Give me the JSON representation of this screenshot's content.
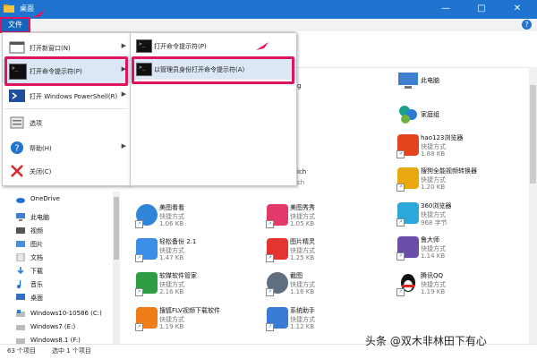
{
  "window": {
    "title": "桌面",
    "controls": {
      "minimize": "—",
      "maximize": "□",
      "close": "✕"
    }
  },
  "ribbon": {
    "file_tab": "文件"
  },
  "file_menu": {
    "items": [
      {
        "label": "打开新窗口(N)",
        "icon": "window-icon",
        "has_submenu": true
      },
      {
        "label": "打开命令提示符(P)",
        "icon": "cmd-icon",
        "has_submenu": true,
        "highlighted": true
      },
      {
        "label": "打开 Windows PowerShell(R)",
        "icon": "powershell-icon",
        "has_submenu": true
      },
      {
        "label": "选项",
        "icon": "options-icon",
        "has_submenu": false
      },
      {
        "label": "帮助(H)",
        "icon": "help-icon",
        "has_submenu": true
      },
      {
        "label": "关闭(C)",
        "icon": "close-icon",
        "has_submenu": false
      }
    ],
    "submenu": [
      {
        "label": "打开命令提示符(P)",
        "icon": "cmd-icon"
      },
      {
        "label": "以管理员身份打开命令提示符(A)",
        "icon": "cmd-admin-icon",
        "highlighted": true
      }
    ]
  },
  "nav": {
    "items": [
      {
        "label": "OneDrive",
        "icon": "cloud-icon"
      },
      {
        "label": "此电脑",
        "icon": "computer-icon"
      },
      {
        "label": "视频",
        "icon": "video-icon"
      },
      {
        "label": "图片",
        "icon": "pictures-icon"
      },
      {
        "label": "文档",
        "icon": "documents-icon"
      },
      {
        "label": "下载",
        "icon": "download-icon"
      },
      {
        "label": "音乐",
        "icon": "music-icon"
      },
      {
        "label": "桌面",
        "icon": "desktop-icon"
      },
      {
        "label": "Windows10-10586 (C:)",
        "icon": "drive-icon"
      },
      {
        "label": "Windows7 (E:)",
        "icon": "drive-icon"
      },
      {
        "label": "Windows8.1 (F:)",
        "icon": "drive-icon"
      }
    ]
  },
  "content": {
    "partial_labels": {
      "a": "g",
      "b": "ich"
    },
    "col2_sizes": [
      "1.06 KB",
      "1.47 KB",
      "2.16 KB",
      "1.19 KB"
    ],
    "tiles": [
      {
        "name": "此电脑",
        "type": "",
        "size": "",
        "color": "#3f7fd1"
      },
      {
        "name": "家庭组",
        "type": "",
        "size": "",
        "color": "#1aa08c"
      },
      {
        "name": "hao123浏览器",
        "type": "快捷方式",
        "size": "1.88 KB",
        "color": "#e4431c"
      },
      {
        "name": "搜狗全能视频转换器",
        "type": "快捷方式",
        "size": "1.20 KB",
        "color": "#e8a80f"
      },
      {
        "name": "360浏览器",
        "type": "快捷方式",
        "size": "968 字节",
        "color": "#2aa7db"
      },
      {
        "name": "鲁大师",
        "type": "快捷方式",
        "size": "1.14 KB",
        "color": "#6a4ea8"
      },
      {
        "name": "腾讯QQ",
        "type": "快捷方式",
        "size": "1.19 KB",
        "color": "#111111"
      },
      {
        "name": "美图看看",
        "type": "快捷方式",
        "size": "1.06 KB",
        "color": "#2f86d9"
      },
      {
        "name": "美图秀秀",
        "type": "快捷方式",
        "size": "1.05 KB",
        "color": "#e23b6b"
      },
      {
        "name": "轻松备份 2.1",
        "type": "快捷方式",
        "size": "1.47 KB",
        "color": "#3a8ee6"
      },
      {
        "name": "图片精灵",
        "type": "快捷方式",
        "size": "1.25 KB",
        "color": "#e3342f"
      },
      {
        "name": "软媒软件管家",
        "type": "快捷方式",
        "size": "2.16 KB",
        "color": "#2e9e44"
      },
      {
        "name": "截图",
        "type": "快捷方式",
        "size": "1.16 KB",
        "color": "#5f6f7f"
      },
      {
        "name": "搜狐FLV视频下载软件",
        "type": "快捷方式",
        "size": "1.19 KB",
        "color": "#f07d1a"
      },
      {
        "name": "系统助手",
        "type": "快捷方式",
        "size": "1.12 KB",
        "color": "#3b7bd8"
      }
    ]
  },
  "status": {
    "count": "63 个项目",
    "selected": "选中 1 个项目"
  },
  "watermark": "头条 @双木非林田下有心",
  "colors": {
    "titlebar": "#1e74cf",
    "highlight_border": "#e0145c",
    "menu_highlight": "#dbe7f5"
  }
}
